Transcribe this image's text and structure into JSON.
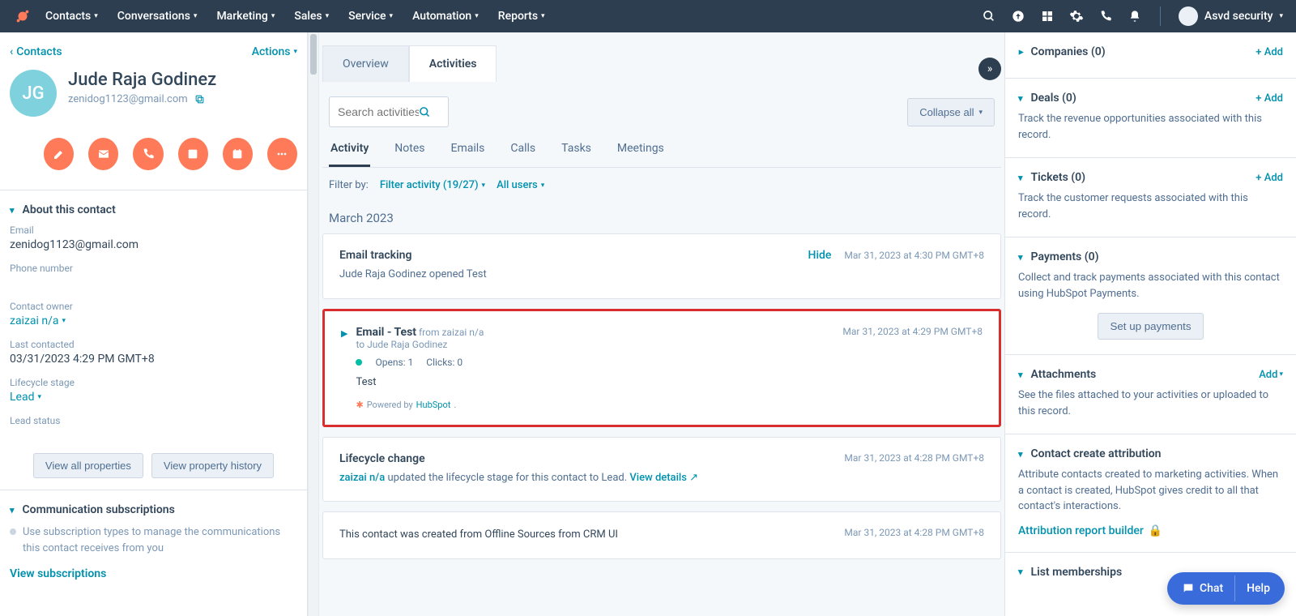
{
  "topnav": {
    "menu": [
      "Contacts",
      "Conversations",
      "Marketing",
      "Sales",
      "Service",
      "Automation",
      "Reports"
    ],
    "account": "Asvd security"
  },
  "left": {
    "back": "Contacts",
    "actions": "Actions",
    "initials": "JG",
    "name": "Jude Raja Godinez",
    "email": "zenidog1123@gmail.com",
    "about_header": "About this contact",
    "props": {
      "email_label": "Email",
      "email_val": "zenidog1123@gmail.com",
      "phone_label": "Phone number",
      "owner_label": "Contact owner",
      "owner_val": "zaizai n/a",
      "last_label": "Last contacted",
      "last_val": "03/31/2023 4:29 PM GMT+8",
      "lifecycle_label": "Lifecycle stage",
      "lifecycle_val": "Lead",
      "leadstatus_label": "Lead status"
    },
    "btn_all": "View all properties",
    "btn_hist": "View property history",
    "comm_header": "Communication subscriptions",
    "comm_desc": "Use subscription types to manage the communications this contact receives from you",
    "view_subs": "View subscriptions"
  },
  "center": {
    "tabs": {
      "overview": "Overview",
      "activities": "Activities"
    },
    "search_placeholder": "Search activities",
    "collapse": "Collapse all",
    "subtabs": [
      "Activity",
      "Notes",
      "Emails",
      "Calls",
      "Tasks",
      "Meetings"
    ],
    "filter_label": "Filter by:",
    "filter_activity": "Filter activity (19/27)",
    "filter_users": "All users",
    "month": "March 2023",
    "cards": {
      "tracking": {
        "title": "Email tracking",
        "body": "Jude Raja Godinez opened Test",
        "hide": "Hide",
        "ts": "Mar 31, 2023 at 4:30 PM GMT+8"
      },
      "email": {
        "title_pre": "Email - Test",
        "from": " from zaizai n/a",
        "to": "to Jude Raja Godinez",
        "opens": "Opens: 1",
        "clicks": "Clicks: 0",
        "body": "Test",
        "powered": "Powered by ",
        "hubspot": "HubSpot",
        "ts": "Mar 31, 2023 at 4:29 PM GMT+8"
      },
      "lifecycle": {
        "title": "Lifecycle change",
        "user": "zaizai n/a",
        "body": " updated the lifecycle stage for this contact to Lead. ",
        "view": "View details",
        "ts": "Mar 31, 2023 at 4:28 PM GMT+8"
      },
      "created": {
        "body": "This contact was created from Offline Sources from CRM UI",
        "ts": "Mar 31, 2023 at 4:28 PM GMT+8"
      }
    }
  },
  "right": {
    "add": "+ Add",
    "companies": "Companies (0)",
    "deals": "Deals (0)",
    "deals_desc": "Track the revenue opportunities associated with this record.",
    "tickets": "Tickets (0)",
    "tickets_desc": "Track the customer requests associated with this record.",
    "payments": "Payments (0)",
    "payments_desc": "Collect and track payments associated with this contact using HubSpot Payments.",
    "payments_btn": "Set up payments",
    "attachments": "Attachments",
    "attach_add": "Add",
    "attach_desc": "See the files attached to your activities or uploaded to this record.",
    "attribution": "Contact create attribution",
    "attribution_desc": "Attribute contacts created to marketing activities. When a contact is created, HubSpot gives credit to all that contact's interactions.",
    "attribution_link": "Attribution report builder",
    "list": "List memberships"
  },
  "chat": {
    "chat": "Chat",
    "help": "Help"
  }
}
